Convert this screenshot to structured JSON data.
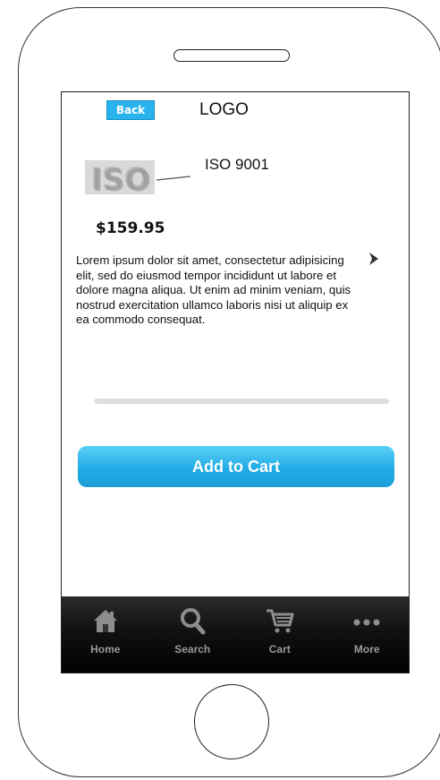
{
  "header": {
    "back_label": "Back",
    "logo_text": "LOGO"
  },
  "product": {
    "title": "ISO 9001",
    "price": "$159.95",
    "description": "Lorem ipsum dolor sit amet, consectetur adipisicing elit, sed do eiusmod tempor incididunt ut labore et dolore magna aliqua. Ut enim ad minim veniam, quis nostrud exercitation ullamco laboris nisi ut aliquip ex ea commodo consequat."
  },
  "actions": {
    "add_to_cart_label": "Add to Cart"
  },
  "tabbar": {
    "tabs": [
      {
        "label": "Home",
        "icon": "home-icon"
      },
      {
        "label": "Search",
        "icon": "search-icon"
      },
      {
        "label": "Cart",
        "icon": "cart-icon"
      },
      {
        "label": "More",
        "icon": "more-icon"
      }
    ]
  },
  "colors": {
    "accent": "#29b3ec",
    "tabbar": "#111111"
  }
}
